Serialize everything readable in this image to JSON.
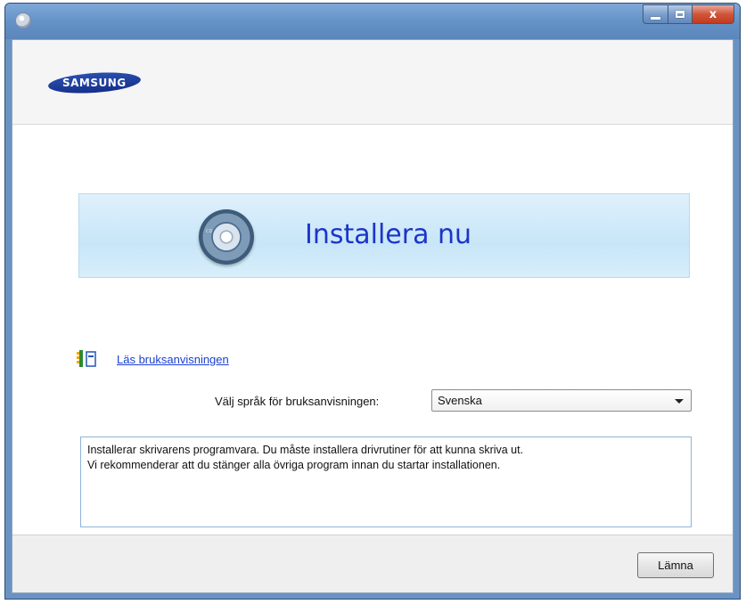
{
  "window": {
    "title": "",
    "controls": {
      "minimize": "minimize",
      "maximize": "maximize",
      "close": "x"
    }
  },
  "header": {
    "logo_text": "SAMSUNG",
    "logo_color": "#1e3f9e"
  },
  "install": {
    "label": "Installera nu",
    "cd_text": "CD",
    "accent": "#1c35c8"
  },
  "manual": {
    "link_text": "Läs bruksanvisningen",
    "icon": "manual-book-icon"
  },
  "language": {
    "label": "Välj språk för bruksanvisningen:",
    "selected": "Svenska"
  },
  "description": {
    "line1": "Installerar skrivarens programvara. Du måste installera drivrutiner för att kunna skriva ut.",
    "line2": "Vi rekommenderar att du stänger alla övriga program innan du startar installationen."
  },
  "footer": {
    "leave_button": "Lämna"
  }
}
